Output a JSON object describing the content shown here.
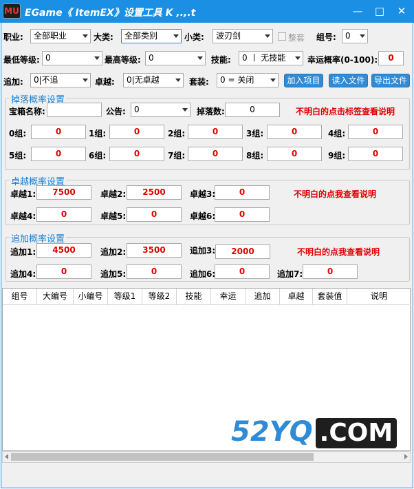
{
  "window": {
    "logo_text": "MU",
    "title": "EGame《 ItemEX》设置工具  K ,.,.t"
  },
  "colors": {
    "accent": "#1a8fe3",
    "button": "#2f8bd6",
    "value_red": "#e00000",
    "group_title": "#1a7fd1"
  },
  "filters": {
    "job_label": "职业:",
    "job_value": "全部职业",
    "category_label": "大类:",
    "category_value": "全部类别",
    "subcategory_label": "小类:",
    "subcategory_value": "波刃剑",
    "whole_set_label": "整套",
    "group_no_label": "组号:",
    "group_no_value": "0",
    "min_level_label": "最低等级:",
    "min_level_value": "0",
    "max_level_label": "最高等级:",
    "max_level_value": "0",
    "skill_label": "技能:",
    "skill_value": "0 丨 无技能",
    "luck_label": "幸运概率(0-100):",
    "luck_value": "0",
    "addition_label": "追加:",
    "addition_value": "0|不追",
    "excellent_label": "卓越:",
    "excellent_value": "0|无卓越",
    "set_label": "套装:",
    "set_value": "0 = 关闭"
  },
  "buttons": {
    "add_item": "加入项目",
    "read_file": "读入文件",
    "export_file": "导出文件"
  },
  "drop_group": {
    "title": "掉落概率设置",
    "chest_name_label": "宝箱名称:",
    "chest_name_value": "",
    "notice_label": "公告:",
    "notice_value": "0",
    "drop_count_label": "掉落数:",
    "drop_count_value": "0",
    "help": "不明白的点击标签查看说明",
    "groups": [
      {
        "label": "0组:",
        "value": "0"
      },
      {
        "label": "1组:",
        "value": "0"
      },
      {
        "label": "2组:",
        "value": "0"
      },
      {
        "label": "3组:",
        "value": "0"
      },
      {
        "label": "4组:",
        "value": "0"
      },
      {
        "label": "5组:",
        "value": "0"
      },
      {
        "label": "6组:",
        "value": "0"
      },
      {
        "label": "7组:",
        "value": "0"
      },
      {
        "label": "8组:",
        "value": "0"
      },
      {
        "label": "9组:",
        "value": "0"
      }
    ]
  },
  "excellent_group": {
    "title": "卓越概率设置",
    "help": "不明白的点我查看说明",
    "fields": [
      {
        "label": "卓越1:",
        "value": "7500"
      },
      {
        "label": "卓越2:",
        "value": "2500"
      },
      {
        "label": "卓越3:",
        "value": "0"
      },
      {
        "label": "卓越4:",
        "value": "0"
      },
      {
        "label": "卓越5:",
        "value": "0"
      },
      {
        "label": "卓越6:",
        "value": "0"
      }
    ]
  },
  "addition_group": {
    "title": "追加概率设置",
    "help": "不明白的点我查看说明",
    "fields": [
      {
        "label": "追加1:",
        "value": "4500"
      },
      {
        "label": "追加2:",
        "value": "3500"
      },
      {
        "label": "追加3:",
        "value": "2000"
      },
      {
        "label": "追加4:",
        "value": "0"
      },
      {
        "label": "追加5:",
        "value": "0"
      },
      {
        "label": "追加6:",
        "value": "0"
      },
      {
        "label": "追加7:",
        "value": "0"
      }
    ]
  },
  "grid": {
    "columns": [
      "组号",
      "大编号",
      "小编号",
      "等级1",
      "等级2",
      "技能",
      "幸运",
      "追加",
      "卓越",
      "套装值",
      "说明"
    ]
  },
  "watermark": {
    "part1": "52YQ",
    "part2": ".COM"
  }
}
